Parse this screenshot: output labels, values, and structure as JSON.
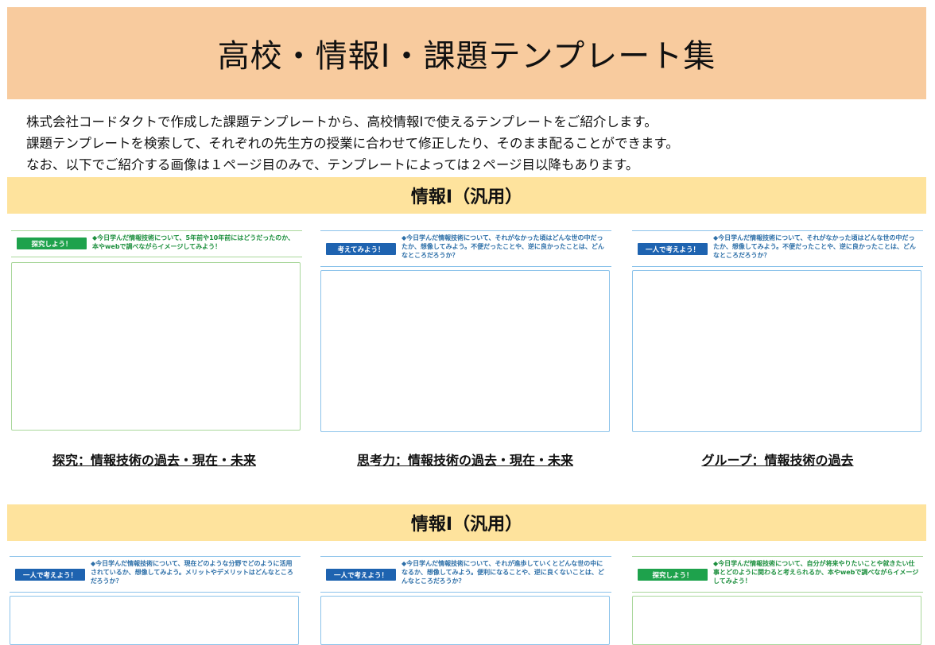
{
  "header": {
    "title": "高校・情報Ⅰ・課題テンプレート集"
  },
  "intro": {
    "lines": [
      "株式会社コードタクトで作成した課題テンプレートから、高校情報Ⅰで使えるテンプレートをご紹介します。",
      "課題テンプレートを検索して、それぞれの先生方の授業に合わせて修正したり、そのまま配ることができます。",
      "なお、以下でご紹介する画像は１ページ目のみで、テンプレートによっては２ページ目以降もあります。"
    ]
  },
  "sections": [
    {
      "title": "情報Ⅰ（汎用）",
      "cards": [
        {
          "badge": "探究しよう！",
          "prompt": "◆今日学んだ情報技術について、5年前や10年前にはどうだったのか、本やwebで調べながらイメージしてみよう！",
          "link": "探究：情報技術の過去・現在・未来",
          "theme_color": "#1ea24c"
        },
        {
          "badge": "考えてみよう！",
          "prompt": "◆今日学んだ情報技術について、それがなかった頃はどんな世の中だったか、想像してみよう。不便だったことや、逆に良かったことは、どんなところだろうか？",
          "link": "思考力：情報技術の過去・現在・未来",
          "theme_color": "#1e63b0"
        },
        {
          "badge": "一人で考えよう！",
          "prompt": "◆今日学んだ情報技術について、それがなかった頃はどんな世の中だったか、想像してみよう。不便だったことや、逆に良かったことは、どんなところだろうか？",
          "link": "グループ：情報技術の過去",
          "theme_color": "#1e63b0"
        }
      ]
    },
    {
      "title": "情報Ⅰ（汎用）",
      "cards": [
        {
          "badge": "一人で考えよう！",
          "prompt": "◆今日学んだ情報技術について、現在どのような分野でどのように活用されているか、想像してみよう。メリットやデメリットはどんなところだろうか？",
          "theme_color": "#1e63b0"
        },
        {
          "badge": "一人で考えよう！",
          "prompt": "◆今日学んだ情報技術について、それが進歩していくとどんな世の中になるか、想像してみよう。便利になることや、逆に良くないことは、どんなところだろうか？",
          "theme_color": "#1e63b0"
        },
        {
          "badge": "探究しよう！",
          "prompt": "◆今日学んだ情報技術について、自分が将来やりたいことや就きたい仕事とどのように関わると考えられるか、本やwebで調べながらイメージしてみよう！",
          "theme_color": "#1ea24c"
        }
      ]
    }
  ]
}
